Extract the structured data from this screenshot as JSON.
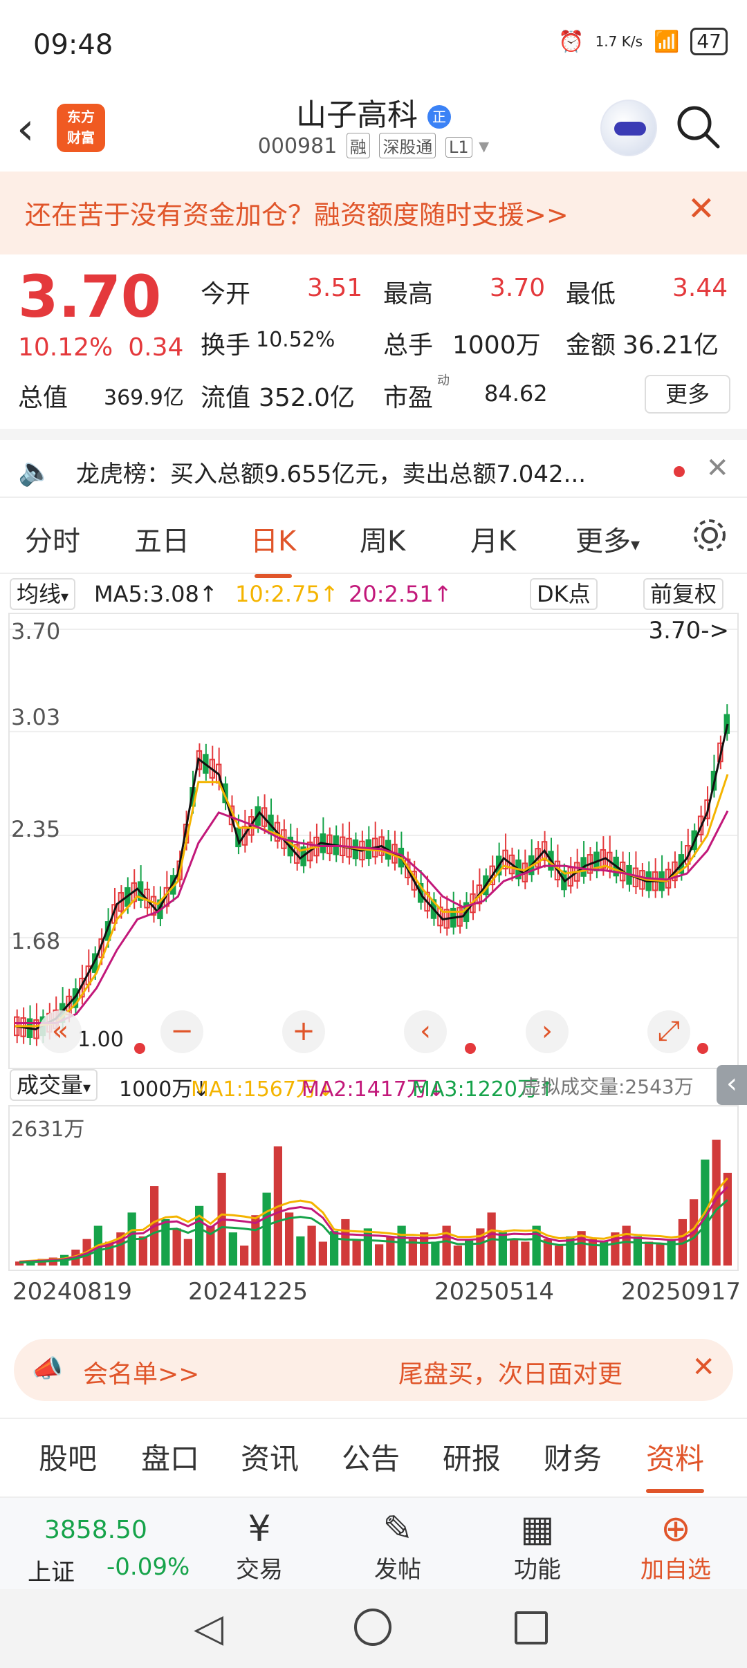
{
  "status": {
    "time": "09:48",
    "net_speed": "1.7 K/s",
    "battery": "47"
  },
  "header": {
    "title": "山子高科",
    "badge": "正",
    "code": "000981",
    "tags": [
      "融",
      "深股通",
      "L1"
    ],
    "logo": "东方财富"
  },
  "banner": {
    "text": "还在苦于没有资金加仓？融资额度随时支援>>"
  },
  "quote": {
    "price": "3.70",
    "pct": "10.12%",
    "change": "0.34",
    "open_label": "今开",
    "open": "3.51",
    "high_label": "最高",
    "high": "3.70",
    "low_label": "最低",
    "low": "3.44",
    "turnover_label": "换手",
    "turnover": "10.52%",
    "volume_label": "总手",
    "volume": "1000万",
    "amount_label": "金额",
    "amount": "36.21亿",
    "mcap_label": "总值",
    "mcap": "369.9亿",
    "float_label": "流值",
    "float": "352.0亿",
    "pe_label": "市盈",
    "pe_sup": "动",
    "pe": "84.62",
    "more": "更多"
  },
  "notice": {
    "text": "龙虎榜：买入总额9.655亿元，卖出总额7.042..."
  },
  "ktabs": [
    "分时",
    "五日",
    "日K",
    "周K",
    "月K",
    "更多"
  ],
  "ma": {
    "label": "均线",
    "ma5": "MA5:3.08↑",
    "ma10": "10:2.75↑",
    "ma20": "20:2.51↑",
    "dk": "DK点",
    "adj": "前复权"
  },
  "chart_data": {
    "type": "line",
    "y_ticks": [
      "3.70",
      "3.03",
      "2.35",
      "1.68"
    ],
    "last_price_label": "3.70->",
    "low_label": "1.00",
    "x_dates": [
      "20240819",
      "20241225",
      "20250514",
      "20250917"
    ],
    "series": [
      {
        "name": "MA5",
        "color": "#111111",
        "values": [
          1.1,
          1.08,
          1.15,
          1.3,
          1.55,
          1.9,
          2.0,
          1.85,
          2.1,
          2.85,
          2.75,
          2.3,
          2.5,
          2.35,
          2.2,
          2.3,
          2.28,
          2.25,
          2.28,
          2.2,
          1.95,
          1.8,
          1.82,
          2.0,
          2.2,
          2.1,
          2.25,
          2.05,
          2.15,
          2.2,
          2.1,
          2.05,
          2.05,
          2.2,
          2.5,
          3.08
        ]
      },
      {
        "name": "MA10",
        "color": "#f4b400",
        "values": [
          1.1,
          1.1,
          1.12,
          1.25,
          1.45,
          1.8,
          1.95,
          1.9,
          2.05,
          2.7,
          2.7,
          2.4,
          2.4,
          2.35,
          2.25,
          2.28,
          2.28,
          2.26,
          2.25,
          2.2,
          2.0,
          1.85,
          1.85,
          1.98,
          2.15,
          2.12,
          2.2,
          2.1,
          2.12,
          2.15,
          2.1,
          2.06,
          2.05,
          2.15,
          2.35,
          2.75
        ]
      },
      {
        "name": "MA20",
        "color": "#c2187a",
        "values": [
          1.12,
          1.12,
          1.12,
          1.18,
          1.35,
          1.6,
          1.8,
          1.85,
          1.95,
          2.3,
          2.5,
          2.45,
          2.4,
          2.33,
          2.3,
          2.28,
          2.28,
          2.27,
          2.26,
          2.22,
          2.1,
          1.95,
          1.88,
          1.92,
          2.05,
          2.1,
          2.15,
          2.15,
          2.13,
          2.12,
          2.1,
          2.07,
          2.06,
          2.1,
          2.25,
          2.51
        ]
      }
    ]
  },
  "volume": {
    "label": "成交量",
    "vol": "1000万↓",
    "ma1": "MA1:1567万↓",
    "ma2": "MA2:1417万↓",
    "ma3": "MA3:1220万↑",
    "virtual": "虚拟成交量:2543万",
    "max_label": "2631万",
    "bars": [
      3,
      4,
      5,
      6,
      8,
      12,
      20,
      30,
      18,
      25,
      40,
      22,
      60,
      35,
      28,
      20,
      45,
      30,
      70,
      25,
      15,
      38,
      55,
      90,
      40,
      22,
      30,
      18,
      26,
      35,
      20,
      28,
      16,
      22,
      30,
      20,
      25,
      18,
      30,
      15,
      20,
      28,
      40,
      25,
      20,
      18,
      30,
      20,
      15,
      22,
      26,
      20,
      18,
      25,
      30,
      22,
      18,
      16,
      20,
      35,
      50,
      80,
      95,
      70
    ]
  },
  "promo": {
    "left": "会名单>>",
    "right": "尾盘买，次日面对更"
  },
  "btabs": [
    "股吧",
    "盘口",
    "资讯",
    "公告",
    "研报",
    "财务",
    "资料"
  ],
  "bottom": {
    "index_value": "3858.50",
    "index_name": "上证",
    "index_chg": "-0.09%",
    "trade": "交易",
    "post": "发帖",
    "func": "功能",
    "watch": "加自选"
  }
}
